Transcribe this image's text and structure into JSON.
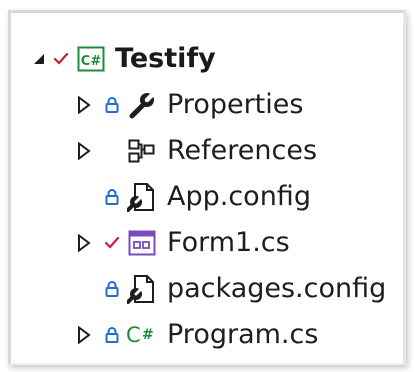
{
  "solution_explorer": {
    "project": {
      "name": "Testify",
      "icon": "csharp-project-icon",
      "status": "checked-in",
      "expanded": true
    },
    "items": [
      {
        "label": "Properties",
        "icon": "wrench-icon",
        "status": "locked",
        "expandable": true
      },
      {
        "label": "References",
        "icon": "references-icon",
        "status": "none",
        "expandable": true
      },
      {
        "label": "App.config",
        "icon": "config-file-icon",
        "status": "locked",
        "expandable": false
      },
      {
        "label": "Form1.cs",
        "icon": "form-icon",
        "status": "checked-in",
        "expandable": true
      },
      {
        "label": "packages.config",
        "icon": "config-file-icon",
        "status": "locked",
        "expandable": false
      },
      {
        "label": "Program.cs",
        "icon": "csharp-file-icon",
        "status": "locked",
        "expandable": true
      }
    ],
    "colors": {
      "checkmark": "#c8203a",
      "lock": "#1f6fd1",
      "csharp_green": "#1e8c3a",
      "form_purple": "#7a4bb8",
      "text": "#1e1e1e"
    }
  }
}
